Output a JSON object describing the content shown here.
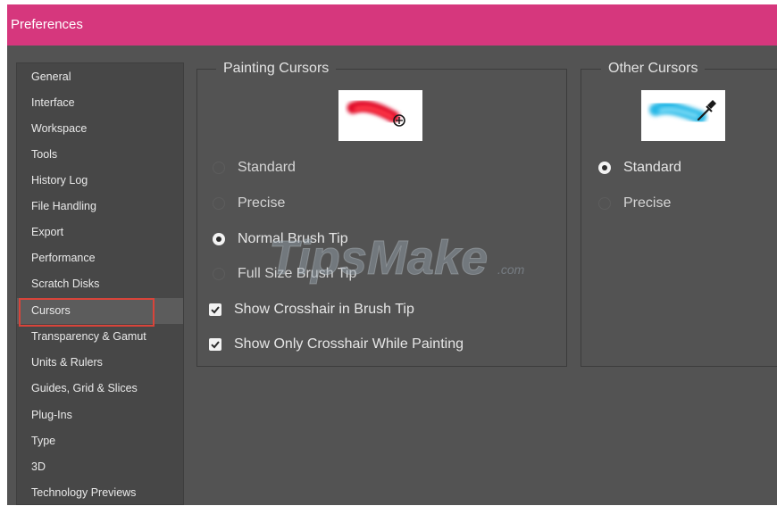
{
  "window": {
    "title": "Preferences"
  },
  "sidebar": {
    "items": [
      {
        "label": "General"
      },
      {
        "label": "Interface"
      },
      {
        "label": "Workspace"
      },
      {
        "label": "Tools"
      },
      {
        "label": "History Log"
      },
      {
        "label": "File Handling"
      },
      {
        "label": "Export"
      },
      {
        "label": "Performance"
      },
      {
        "label": "Scratch Disks"
      },
      {
        "label": "Cursors"
      },
      {
        "label": "Transparency & Gamut"
      },
      {
        "label": "Units & Rulers"
      },
      {
        "label": "Guides, Grid & Slices"
      },
      {
        "label": "Plug-Ins"
      },
      {
        "label": "Type"
      },
      {
        "label": "3D"
      },
      {
        "label": "Technology Previews"
      }
    ],
    "selected": "Cursors"
  },
  "painting_cursors": {
    "title": "Painting Cursors",
    "preview_icon": "red-brush-stroke-with-crosshair-circle",
    "options": [
      {
        "label": "Standard",
        "selected": false
      },
      {
        "label": "Precise",
        "selected": false
      },
      {
        "label": "Normal Brush Tip",
        "selected": true
      },
      {
        "label": "Full Size Brush Tip",
        "selected": false
      }
    ],
    "checkboxes": [
      {
        "label": "Show Crosshair in Brush Tip",
        "checked": true
      },
      {
        "label": "Show Only Crosshair While Painting",
        "checked": true
      }
    ]
  },
  "other_cursors": {
    "title": "Other Cursors",
    "preview_icon": "blue-brush-stroke-with-eyedropper",
    "options": [
      {
        "label": "Standard",
        "selected": true
      },
      {
        "label": "Precise",
        "selected": false
      }
    ]
  },
  "watermark": {
    "text": "TipsMake",
    "suffix": ".com"
  },
  "colors": {
    "titlebar": "#d6377d",
    "panel": "#535353",
    "sidebar": "#474747",
    "highlight": "#d9443a"
  }
}
